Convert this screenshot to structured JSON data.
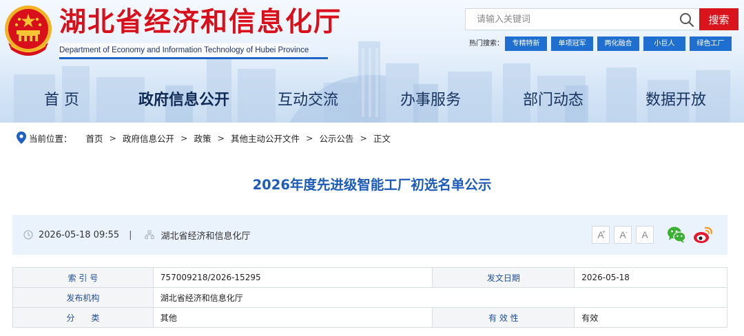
{
  "header": {
    "title": "湖北省经济和信息化厅",
    "subtitle": "Department of Economy and Information Technology of Hubei Province"
  },
  "search": {
    "placeholder": "请输入关键词",
    "button_label": "搜索"
  },
  "hot_search": {
    "label": "热门搜索：",
    "tags": [
      "专精特新",
      "单项冠军",
      "两化融合",
      "小巨人",
      "绿色工厂"
    ]
  },
  "nav": {
    "items": [
      "首  页",
      "政府信息公开",
      "互动交流",
      "办事服务",
      "部门动态",
      "数据开放"
    ],
    "active_index": 1
  },
  "breadcrumb": {
    "label": "当前位置：",
    "items": [
      "首页",
      "政府信息公开",
      "政策",
      "其他主动公开文件",
      "公示公告",
      "正文"
    ],
    "separator": ">"
  },
  "article": {
    "title": "2026年度先进级智能工厂初选名单公示"
  },
  "meta": {
    "date": "2026-05-18 09:55",
    "separator": "|",
    "source": "湖北省经济和信息化厅",
    "font_buttons": [
      "A",
      "A",
      "A"
    ],
    "font_button_marks": [
      "+",
      "-",
      ""
    ]
  },
  "info_table": {
    "rows": [
      [
        {
          "label": "索 引 号",
          "value": "757009218/2026-15295"
        },
        {
          "label": "发文日期",
          "value": "2026-05-18"
        }
      ],
      [
        {
          "label": "发布机构",
          "value": "湖北省经济和信息化厅"
        }
      ],
      [
        {
          "label": "分　　类",
          "value": "其他"
        },
        {
          "label": "有 效 性",
          "value": "有效"
        }
      ]
    ]
  },
  "colors": {
    "brand_red": "#d8101c",
    "nav_text": "#16325e",
    "title_blue": "#1d5bb8",
    "tag_blue": "#1e6fd0",
    "meta_bg": "#eaf2fb"
  },
  "icons": [
    "national-emblem-icon",
    "search-icon",
    "location-pin-icon",
    "clock-icon",
    "org-icon",
    "wechat-icon",
    "weibo-icon"
  ]
}
